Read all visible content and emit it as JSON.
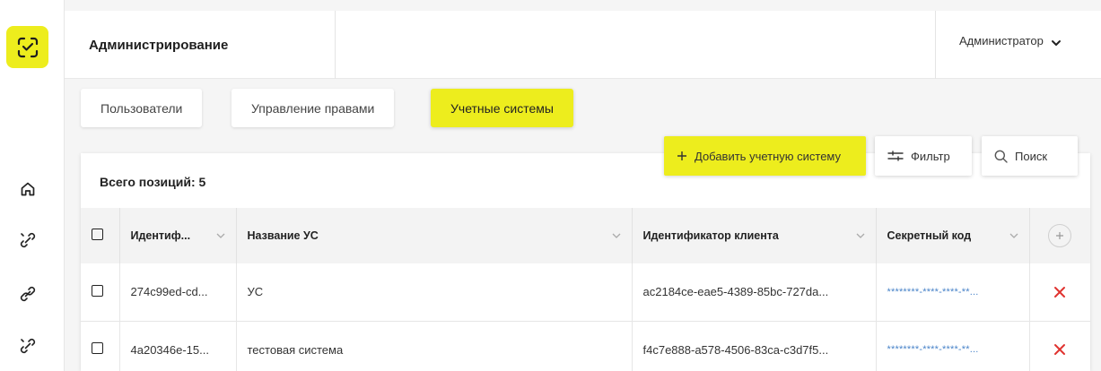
{
  "header": {
    "page_title": "Администрирование",
    "user_name": "Администратор"
  },
  "tabs": [
    {
      "label": "Пользователи",
      "active": false
    },
    {
      "label": "Управление правами",
      "active": false
    },
    {
      "label": "Учетные системы",
      "active": true
    }
  ],
  "toolbar": {
    "add_label": "Добавить учетную систему",
    "filter_label": "Фильтр",
    "search_label": "Поиск"
  },
  "summary": {
    "total_label": "Всего позиций: 5"
  },
  "table": {
    "columns": [
      "Идентиф...",
      "Название УС",
      "Идентификатор клиента",
      "Секретный код"
    ],
    "rows": [
      {
        "id": "274c99ed-cd...",
        "name": "УС",
        "client_id": "ac2184ce-eae5-4389-85bc-727da...",
        "secret": "********-****-****-**..."
      },
      {
        "id": "4a20346e-15...",
        "name": "тестовая система",
        "client_id": "f4c7e888-a578-4506-83ca-c3d7f5...",
        "secret": "********-****-****-**..."
      }
    ]
  },
  "colors": {
    "accent": "#eded1d",
    "delete": "#e0332f",
    "secret_text": "#4a84c9"
  },
  "icons": {
    "logo": "scan-face-icon",
    "nav": [
      "home-icon",
      "link-off-icon",
      "link-icon",
      "link-off-icon"
    ],
    "user_menu": "chevron-down-icon",
    "add": "plus-icon",
    "filter": "sliders-icon",
    "search": "search-icon",
    "add_column": "plus-circle-icon",
    "delete": "close-icon"
  }
}
